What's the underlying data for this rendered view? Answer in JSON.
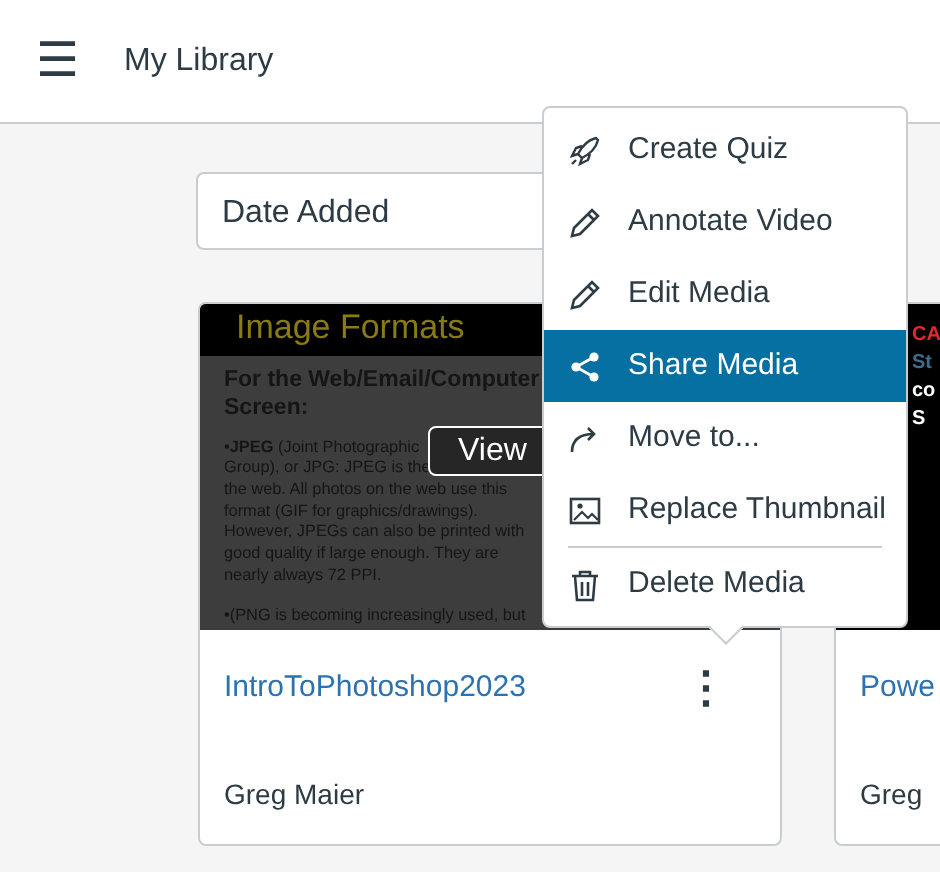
{
  "header": {
    "menu_glyph": "☰",
    "title": "My Library"
  },
  "sort": {
    "value": "Date Added"
  },
  "cards": [
    {
      "kind": "document",
      "doc_title": "Image Formats",
      "doc_heading": [
        "For the Web/Email/Computer",
        "Screen:"
      ],
      "doc_lines": [
        "•**JPEG** (Joint Photographic",
        "Group), or JPG: JPEG is the",
        "the web. All photos on the web use this",
        "format (GIF for graphics/drawings).",
        "However, JPEGs can also be printed with",
        "good quality if large enough. They are",
        "nearly always 72 PPI."
      ],
      "doc_lines_2": [
        "•(PNG is becoming increasingly used, but"
      ],
      "hover_button": "View",
      "title": "IntroToPhotoshop2023",
      "author": "Greg Maier",
      "more_glyph": "⋮"
    },
    {
      "kind": "slide",
      "slide_lines": [
        {
          "text": "CA",
          "color": "#e8262b"
        },
        {
          "text": "St",
          "color": "#3b6e8c"
        },
        {
          "text": "co",
          "color": "#ffffff"
        },
        {
          "text": "S",
          "color": "#ffffff"
        }
      ],
      "title": "Powe",
      "author": "Greg"
    }
  ],
  "menu": [
    {
      "label": "Create Quiz",
      "selected": false
    },
    {
      "label": "Annotate Video",
      "selected": false
    },
    {
      "label": "Edit Media",
      "selected": false
    },
    {
      "label": "Share Media",
      "selected": true
    },
    {
      "label": "Move to...",
      "selected": false
    },
    {
      "label": "Replace Thumbnail",
      "selected": false,
      "divider_after": true
    },
    {
      "label": "Delete Media",
      "selected": false
    }
  ]
}
